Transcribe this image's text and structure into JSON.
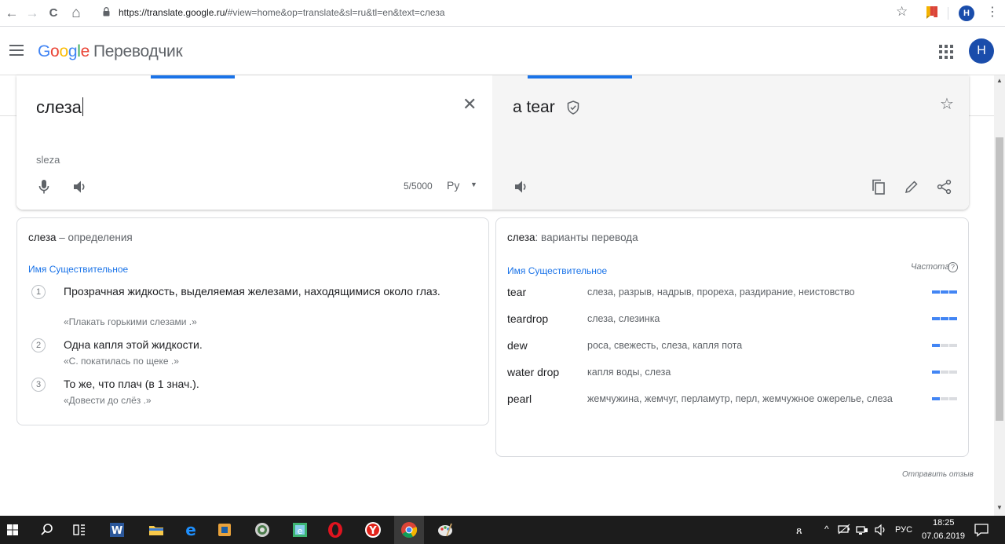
{
  "browser": {
    "back": "←",
    "forward": "→",
    "reload": "C",
    "home": "⌂",
    "url_host": "https://translate.google.ru/",
    "url_path": "#view=home&op=translate&sl=ru&tl=en&text=слеза",
    "star": "☆",
    "avatar_letter": "H",
    "menu": "⋮"
  },
  "header": {
    "logo": {
      "g1": "G",
      "g2": "o",
      "g3": "o",
      "g4": "g",
      "g5": "l",
      "g6": "e"
    },
    "product": "Переводчик",
    "avatar_letter": "Н"
  },
  "source": {
    "text": "слеза",
    "clear": "✕",
    "transliteration": "sleza",
    "char_count": "5/5000",
    "keyboard_lang": "Ру",
    "keyboard_caret": "▼"
  },
  "target": {
    "text": "a tear",
    "star": "☆"
  },
  "definitions": {
    "word": "слеза",
    "suffix": " – определения",
    "pos": "Имя Существительное",
    "items": [
      {
        "num": "1",
        "text": "Прозрачная жидкость, выделяемая железами, находящимися около глаз.",
        "example": "«Плакать горькими слезами .»"
      },
      {
        "num": "2",
        "text": "Одна капля этой жидкости.",
        "example": "«С. покатилась по щеке .»"
      },
      {
        "num": "3",
        "text": "То же, что плач (в 1 знач.).",
        "example": "«Довести до слёз .»"
      }
    ]
  },
  "translations": {
    "word": "слеза",
    "suffix": ": варианты перевода",
    "pos": "Имя Существительное",
    "frequency_label": "Частота",
    "frequency_help": "?",
    "rows": [
      {
        "word": "tear",
        "synonyms": "слеза, разрыв, надрыв, прореха, раздирание, неистовство",
        "frequency": 3
      },
      {
        "word": "teardrop",
        "synonyms": "слеза, слезинка",
        "frequency": 3
      },
      {
        "word": "dew",
        "synonyms": "роса, свежесть, слеза, капля пота",
        "frequency": 1
      },
      {
        "word": "water drop",
        "synonyms": "капля воды, слеза",
        "frequency": 1
      },
      {
        "word": "pearl",
        "synonyms": "жемчужина, жемчуг, перламутр, перл, жемчужное ожерелье, слеза",
        "frequency": 1
      }
    ]
  },
  "feedback": "Отправить отзыв",
  "taskbar": {
    "lang": "РУС",
    "time": "18:25",
    "date": "07.06.2019",
    "tray_arrow": "^",
    "tray_people": "ጸ"
  },
  "colors": {
    "accent": "#1a73e8",
    "freq_on": "#4285f4",
    "freq_off": "#dadce0",
    "avatar": "#1a4dab"
  }
}
